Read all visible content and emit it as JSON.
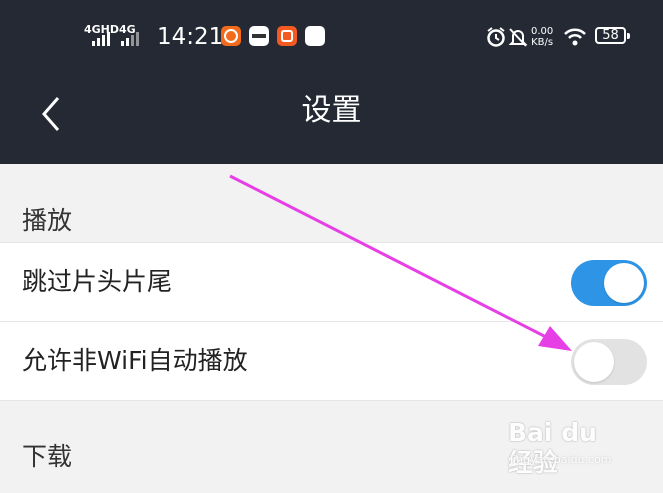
{
  "status_bar": {
    "sim1": "4GHD",
    "sim2": "4G",
    "time": "14:21",
    "net_speed_value": "0.00",
    "net_speed_unit": "KB/s",
    "battery": "58"
  },
  "header": {
    "title": "设置"
  },
  "sections": [
    {
      "title": "播放",
      "rows": [
        {
          "label": "跳过片头片尾",
          "toggle_state": "on"
        },
        {
          "label": "允许非WiFi自动播放",
          "toggle_state": "off"
        }
      ]
    },
    {
      "title": "下载"
    }
  ],
  "watermark": {
    "main": "Bai du 经验",
    "sub": "jingyan.baidu.com"
  },
  "colors": {
    "bar_background": "#242934",
    "toggle_on": "#2e95e6",
    "toggle_off": "#e2e2e2",
    "annotation_arrow": "#e63fe6",
    "page_background": "#f2f2f2"
  }
}
